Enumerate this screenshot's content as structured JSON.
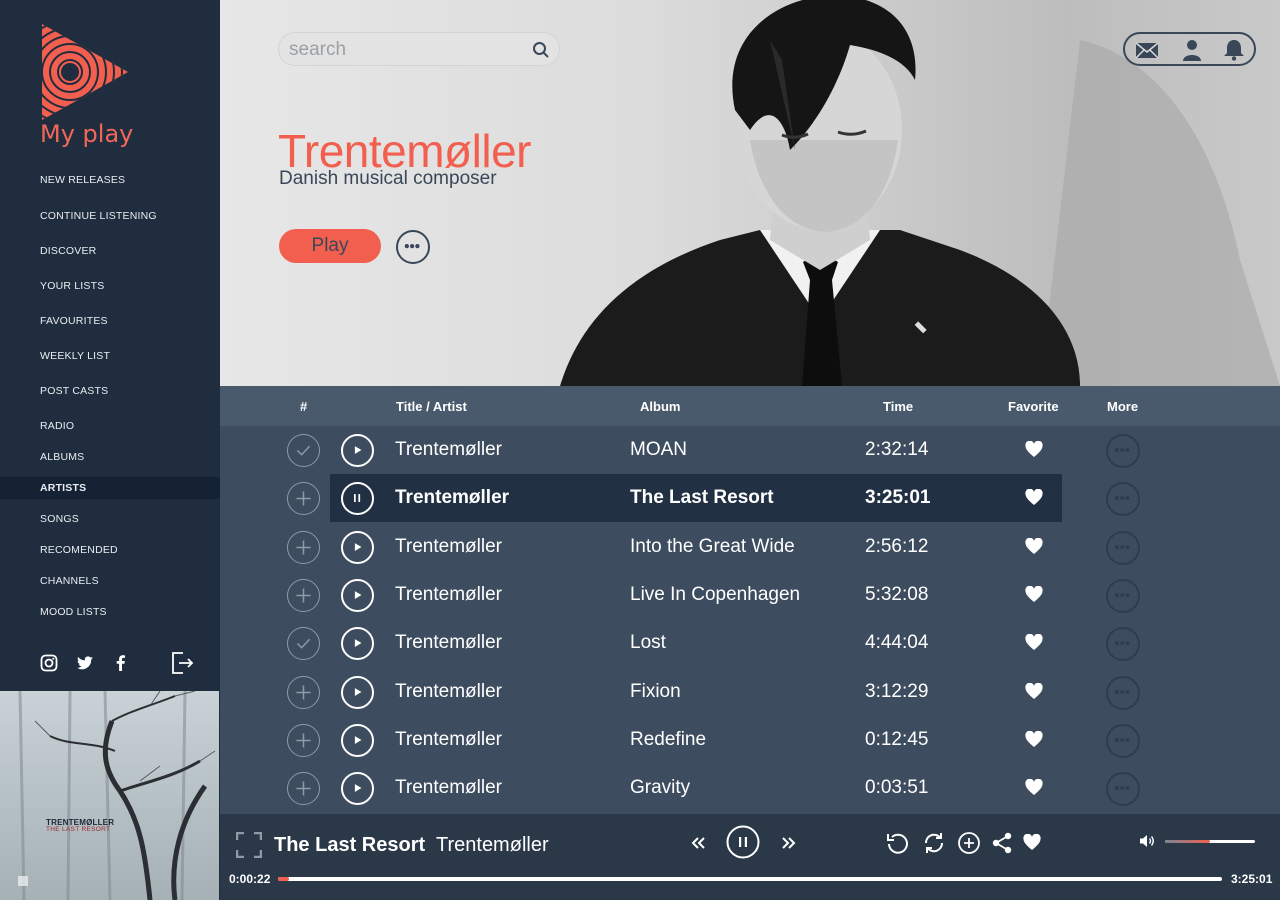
{
  "app": {
    "name": "My play"
  },
  "sidebar": {
    "items": [
      {
        "label": "NEW RELEASES"
      },
      {
        "label": "CONTINUE LISTENING"
      },
      {
        "label": "DISCOVER"
      },
      {
        "label": "YOUR LISTS"
      },
      {
        "label": "FAVOURITES"
      },
      {
        "label": "WEEKLY LIST"
      },
      {
        "label": "POST CASTS"
      },
      {
        "label": "RADIO"
      },
      {
        "label": "ALBUMS"
      },
      {
        "label": "ARTISTS",
        "active": true
      },
      {
        "label": "SONGS"
      },
      {
        "label": "RECOMENDED"
      },
      {
        "label": "CHANNELS"
      },
      {
        "label": "MOOD LISTS"
      }
    ],
    "socials": [
      "instagram-icon",
      "twitter-icon",
      "facebook-icon",
      "logout-icon"
    ],
    "album_art": {
      "line1": "TRENTEMØLLER",
      "line2": "THE LAST RESORT"
    }
  },
  "header": {
    "search": {
      "placeholder": "search",
      "value": ""
    },
    "icons": [
      "mail-icon",
      "user-icon",
      "bell-icon"
    ]
  },
  "artist": {
    "name": "Trentemøller",
    "description": "Danish musical composer",
    "play_label": "Play"
  },
  "table": {
    "columns": {
      "num": "#",
      "title": "Title / Artist",
      "album": "Album",
      "time": "Time",
      "favorite": "Favorite",
      "more": "More"
    },
    "rows": [
      {
        "artist": "Trentemøller",
        "album": "MOAN",
        "time": "2:32:14",
        "added": true,
        "playing": false
      },
      {
        "artist": "Trentemøller",
        "album": "The Last Resort",
        "time": "3:25:01",
        "added": false,
        "playing": true
      },
      {
        "artist": "Trentemøller",
        "album": "Into the Great Wide",
        "time": "2:56:12",
        "added": false,
        "playing": false
      },
      {
        "artist": "Trentemøller",
        "album": "Live In Copenhagen",
        "time": "5:32:08",
        "added": false,
        "playing": false
      },
      {
        "artist": "Trentemøller",
        "album": "Lost",
        "time": "4:44:04",
        "added": true,
        "playing": false
      },
      {
        "artist": "Trentemøller",
        "album": "Fixion",
        "time": "3:12:29",
        "added": false,
        "playing": false
      },
      {
        "artist": "Trentemøller",
        "album": "Redefine",
        "time": "0:12:45",
        "added": false,
        "playing": false
      },
      {
        "artist": "Trentemøller",
        "album": "Gravity",
        "time": "0:03:51",
        "added": false,
        "playing": false
      }
    ]
  },
  "player": {
    "title": "The Last Resort",
    "artist": "Trentemøller",
    "current_time": "0:00:22",
    "total_time": "3:25:01",
    "progress": 0.012,
    "volume": 0.5
  },
  "colors": {
    "accent": "#f25f4f",
    "sidebar": "#1f2d3e",
    "content": "#3d4c5e",
    "player": "#2a3848"
  }
}
